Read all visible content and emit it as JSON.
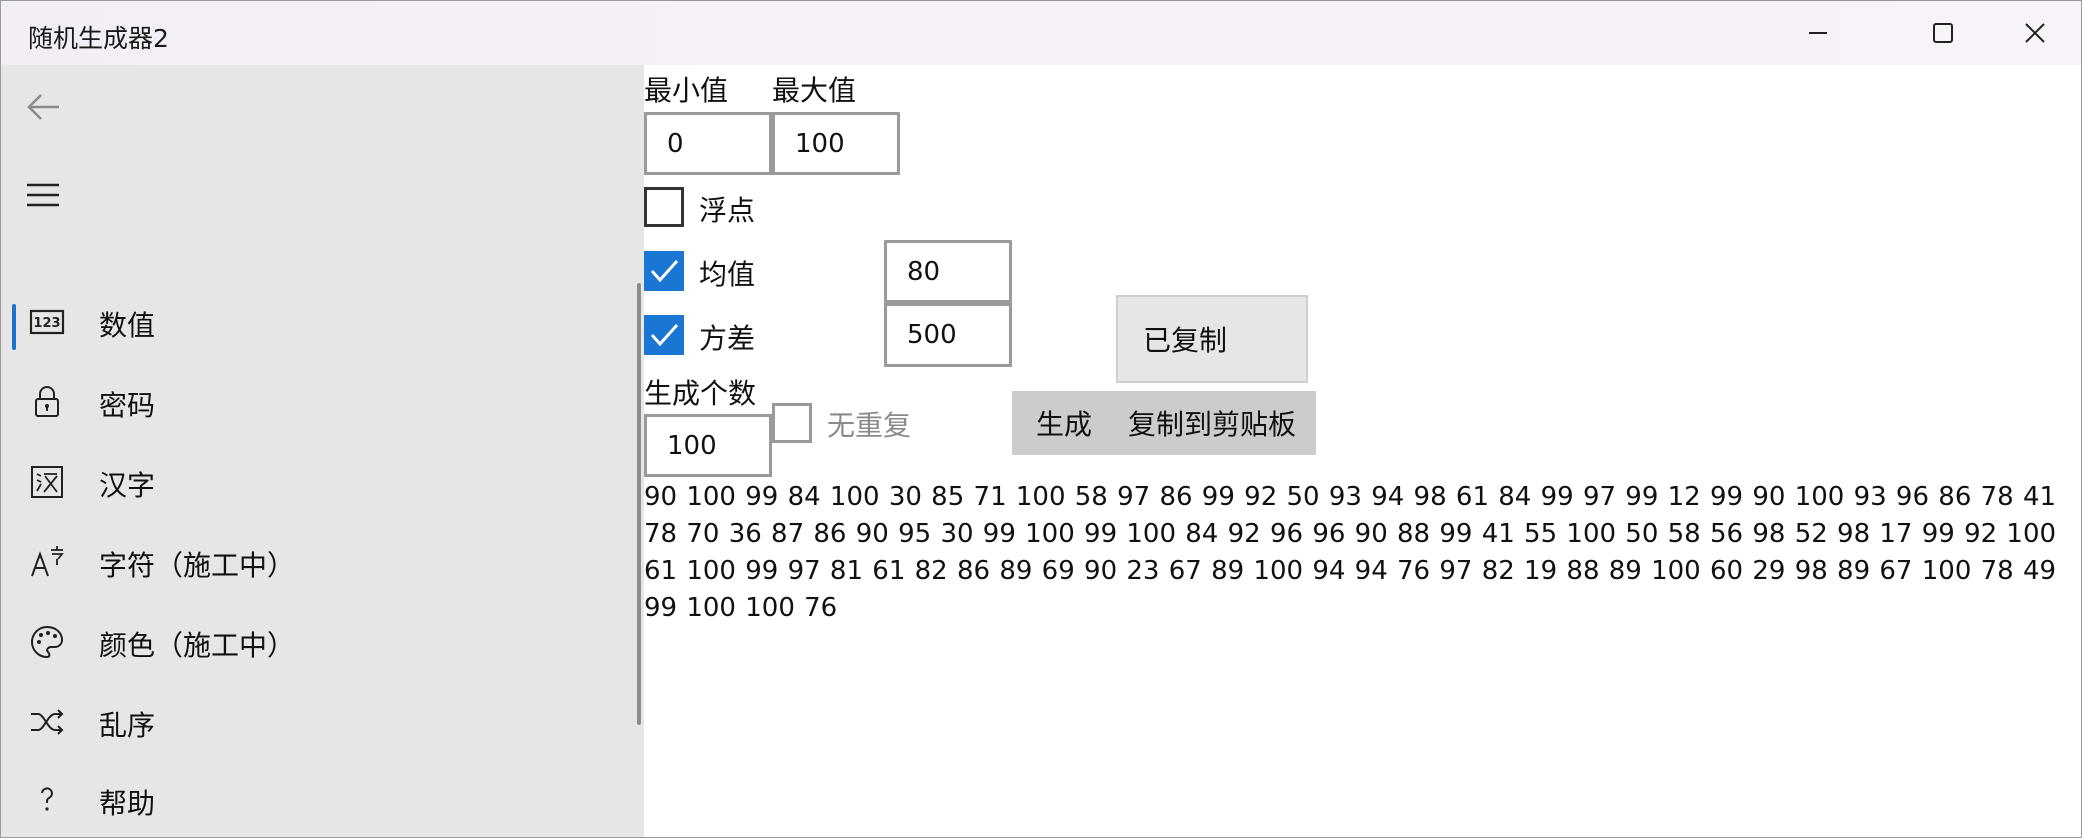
{
  "window": {
    "title": "随机生成器2"
  },
  "sidebar": {
    "items": [
      {
        "label": "数值",
        "icon": "numbers-123-icon"
      },
      {
        "label": "密码",
        "icon": "lock-icon"
      },
      {
        "label": "汉字",
        "icon": "chinese-char-icon"
      },
      {
        "label": "字符（施工中）",
        "icon": "font-character-icon"
      },
      {
        "label": "颜色（施工中）",
        "icon": "palette-icon"
      },
      {
        "label": "乱序",
        "icon": "shuffle-icon"
      },
      {
        "label": "帮助",
        "icon": "question-icon"
      }
    ],
    "selected": "数值"
  },
  "main": {
    "min_label": "最小值",
    "max_label": "最大值",
    "min_value": "0",
    "max_value": "100",
    "float_label": "浮点",
    "float_checked": false,
    "mean_label": "均值",
    "mean_checked": true,
    "mean_value": "80",
    "variance_label": "方差",
    "variance_checked": true,
    "variance_value": "500",
    "copied_label": "已复制",
    "count_label": "生成个数",
    "count_value": "100",
    "no_repeat_label": "无重复",
    "no_repeat_checked": false,
    "generate_label": "生成",
    "copy_label": "复制到剪贴板",
    "output_text": "90 100 99 84 100 30 85 71 100 58 97 86 99 92 50 93 94 98 61 84 99 97 99 12 99 90 100 93 96 86 78 41 78 70 36 87 86 90 95 30 99 100 99 100 84 92 96 96 90 88 99 41 55 100 50 58 56 98 52 98 17 99 92 100 61 100 99 97 81 61 82 86 89 69 90 23 67 89 100 94 94 76 97 82 19 88 89 100 60 29 98 89 67 100 78 49 99 100 100 76"
  },
  "colors": {
    "accent": "#1976d2",
    "sidebar_bg": "#e6e6e6",
    "button_bg": "#cccccc"
  }
}
